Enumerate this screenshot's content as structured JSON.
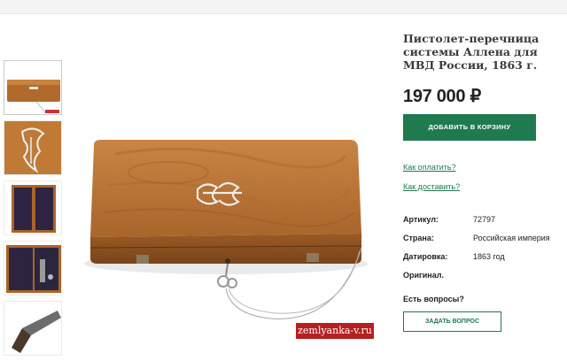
{
  "product": {
    "title": "Пистолет-перечница системы Аллена для МВД России, 1863 г.",
    "price": "197 000 ₽",
    "buy_label": "ДОБАВИТЬ В КОРЗИНУ",
    "how_to_pay": "Как оплатить?",
    "how_to_deliver": "Как доставить?",
    "specs": [
      {
        "key": "Артикул:",
        "value": "72797"
      },
      {
        "key": "Страна:",
        "value": "Российская империя"
      },
      {
        "key": "Датировка:",
        "value": "1863 год"
      },
      {
        "key": "Оригинал.",
        "value": ""
      }
    ],
    "questions_label": "Есть вопросы?",
    "ask_label": "ЗАДАТЬ ВОПРОС"
  },
  "gallery": {
    "watermark": "zemlyanka-v.ru",
    "thumbnails": [
      "case-closed-thumb",
      "monogram-thumb",
      "case-open-thumb",
      "case-open-pistol-thumb",
      "pistol-thumb"
    ]
  },
  "colors": {
    "accent": "#1f7a4f",
    "wood": "#b5712f",
    "watermark": "#b51f1f"
  }
}
